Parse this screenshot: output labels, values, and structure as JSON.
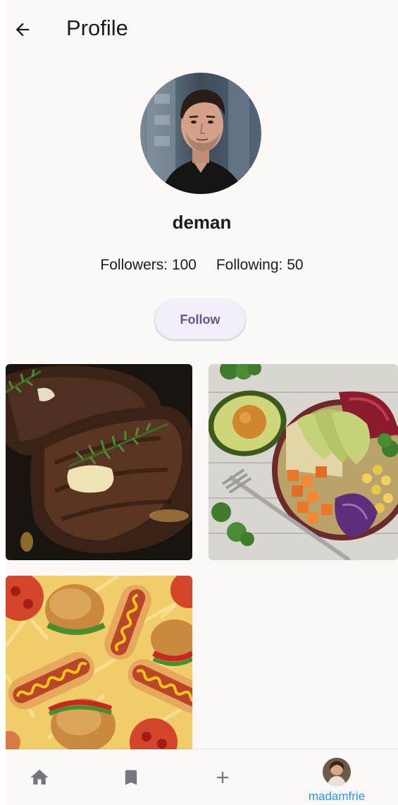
{
  "header": {
    "title": "Profile",
    "back_icon": "arrow-back-icon"
  },
  "profile": {
    "username": "deman",
    "followers_text": "Followers: 100",
    "following_text": "Following: 50",
    "follow_label": "Follow"
  },
  "posts": [
    {
      "subject": "steak"
    },
    {
      "subject": "avocado-bowl"
    },
    {
      "subject": "hot-dogs-burgers"
    }
  ],
  "nav": {
    "items": [
      {
        "icon": "home-icon"
      },
      {
        "icon": "bookmark-icon"
      },
      {
        "icon": "add-icon"
      },
      {
        "label": "madamfrie",
        "icon": "account-avatar"
      }
    ],
    "active_color": "#2196f3"
  },
  "colors": {
    "background": "#fdf8f8",
    "follow_button_bg": "#f3edf7",
    "follow_button_text": "#65558f",
    "nav_icon": "#79747e"
  }
}
